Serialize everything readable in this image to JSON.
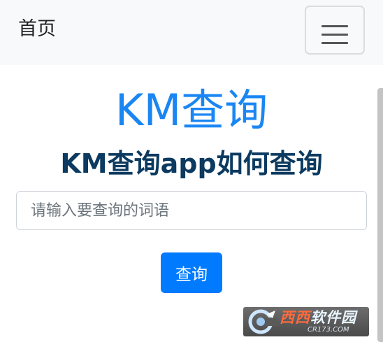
{
  "navbar": {
    "brand": "首页",
    "toggler_icon": "hamburger-menu-icon"
  },
  "main": {
    "title": "KM查询",
    "subtitle": "KM查询app如何查询",
    "search_placeholder": "请输入要查询的词语",
    "search_value": "",
    "search_button_label": "查询"
  },
  "watermark": {
    "brand_part1": "西西",
    "brand_part2": "软件园",
    "url": "CR173.COM"
  },
  "colors": {
    "title_blue": "#1a86f3",
    "subtitle_navy": "#0c3a60",
    "button_blue": "#007bff",
    "navbar_bg": "#f8f9fa"
  }
}
